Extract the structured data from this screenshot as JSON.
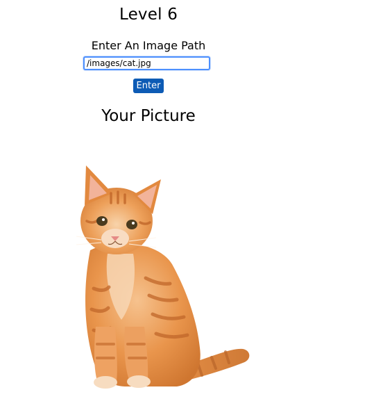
{
  "header": {
    "title": "Level 6"
  },
  "form": {
    "prompt": "Enter An Image Path",
    "input_value": "/images/cat.jpg",
    "submit_label": "Enter"
  },
  "result": {
    "heading": "Your Picture",
    "image_subject": "orange-tabby-kitten"
  },
  "colors": {
    "button_bg": "#0d5bb5",
    "input_focus_border": "#4d90fe",
    "kitten_fur": "#e8924a"
  }
}
